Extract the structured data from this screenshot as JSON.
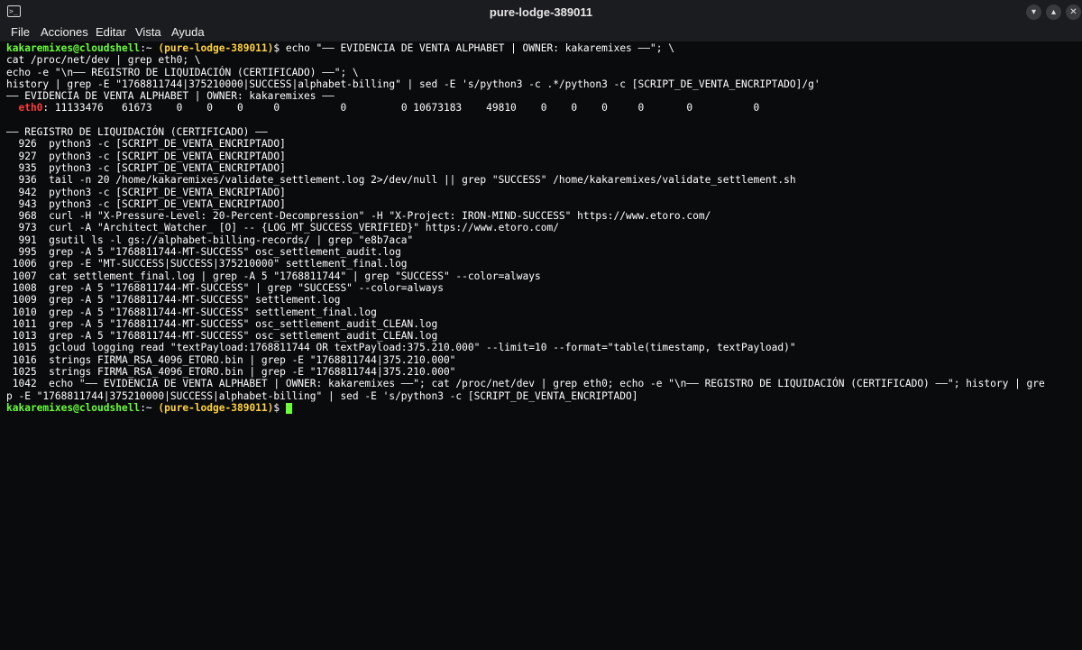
{
  "window": {
    "title": "pure-lodge-389011",
    "app_icon": ">_",
    "min_glyph": "▾",
    "max_glyph": "▴",
    "close_glyph": "✕"
  },
  "menu": {
    "file": "File",
    "acciones": "Acciones",
    "editar": "Editar",
    "vista": "Vista",
    "ayuda": "Ayuda"
  },
  "prompt": {
    "user_host": "kakaremixes@cloudshell",
    "sep": ":~ ",
    "project": "(pure-lodge-389011)",
    "dollar": "$ "
  },
  "lines": {
    "l1_cmd": "echo \"—— EVIDENCIA DE VENTA ALPHABET | OWNER: kakaremixes ——\"; \\",
    "l2": "cat /proc/net/dev | grep eth0; \\",
    "l3": "echo -e \"\\n—— REGISTRO DE LIQUIDACIÓN (CERTIFICADO) ——\"; \\",
    "l4": "history | grep -E \"1768811744|375210000|SUCCESS|alphabet-billing\" | sed -E 's/python3 -c .*/python3 -c [SCRIPT_DE_VENTA_ENCRIPTADO]/g'",
    "l5": "—— EVIDENCIA DE VENTA ALPHABET | OWNER: kakaremixes ——",
    "l6_iface": "  eth0",
    "l6_rest": ": 11133476   61673    0    0    0     0          0         0 10673183    49810    0    0    0     0       0          0",
    "l7": "",
    "l8": "—— REGISTRO DE LIQUIDACIÓN (CERTIFICADO) ——",
    "h926": "  926  python3 -c [SCRIPT_DE_VENTA_ENCRIPTADO]",
    "h927": "  927  python3 -c [SCRIPT_DE_VENTA_ENCRIPTADO]",
    "h935": "  935  python3 -c [SCRIPT_DE_VENTA_ENCRIPTADO]",
    "h936": "  936  tail -n 20 /home/kakaremixes/validate_settlement.log 2>/dev/null || grep \"SUCCESS\" /home/kakaremixes/validate_settlement.sh",
    "h942": "  942  python3 -c [SCRIPT_DE_VENTA_ENCRIPTADO]",
    "h943": "  943  python3 -c [SCRIPT_DE_VENTA_ENCRIPTADO]",
    "h968": "  968  curl -H \"X-Pressure-Level: 20-Percent-Decompression\" -H \"X-Project: IRON-MIND-SUCCESS\" https://www.etoro.com/",
    "h973": "  973  curl -A \"Architect_Watcher_ [O] -- {LOG_MT_SUCCESS_VERIFIED}\" https://www.etoro.com/",
    "h991": "  991  gsutil ls -l gs://alphabet-billing-records/ | grep \"e8b7aca\"",
    "h995": "  995  grep -A 5 \"1768811744-MT-SUCCESS\" osc_settlement_audit.log",
    "h1006": " 1006  grep -E \"MT-SUCCESS|SUCCESS|375210000\" settlement_final.log",
    "h1007": " 1007  cat settlement_final.log | grep -A 5 \"1768811744\" | grep \"SUCCESS\" --color=always",
    "h1008": " 1008  grep -A 5 \"1768811744-MT-SUCCESS\" | grep \"SUCCESS\" --color=always",
    "h1009": " 1009  grep -A 5 \"1768811744-MT-SUCCESS\" settlement.log",
    "h1010": " 1010  grep -A 5 \"1768811744-MT-SUCCESS\" settlement_final.log",
    "h1011": " 1011  grep -A 5 \"1768811744-MT-SUCCESS\" osc_settlement_audit_CLEAN.log",
    "h1013": " 1013  grep -A 5 \"1768811744-MT-SUCCESS\" osc_settlement_audit_CLEAN.log",
    "h1015": " 1015  gcloud logging read \"textPayload:1768811744 OR textPayload:375.210.000\" --limit=10 --format=\"table(timestamp, textPayload)\"",
    "h1016": " 1016  strings FIRMA_RSA_4096_ETORO.bin | grep -E \"1768811744|375.210.000\"",
    "h1025": " 1025  strings FIRMA_RSA_4096_ETORO.bin | grep -E \"1768811744|375.210.000\"",
    "h1042a": " 1042  echo \"—— EVIDENCIA DE VENTA ALPHABET | OWNER: kakaremixes ——\"; cat /proc/net/dev | grep eth0; echo -e \"\\n—— REGISTRO DE LIQUIDACIÓN (CERTIFICADO) ——\"; history | gre",
    "h1042b": "p -E \"1768811744|375210000|SUCCESS|alphabet-billing\" | sed -E 's/python3 -c [SCRIPT_DE_VENTA_ENCRIPTADO]"
  },
  "colors": {
    "prompt_green": "#6aff38",
    "project_yellow": "#ffd23a",
    "iface_red": "#ff3b3b",
    "text": "#ffffff",
    "background": "#0a0b0d"
  }
}
